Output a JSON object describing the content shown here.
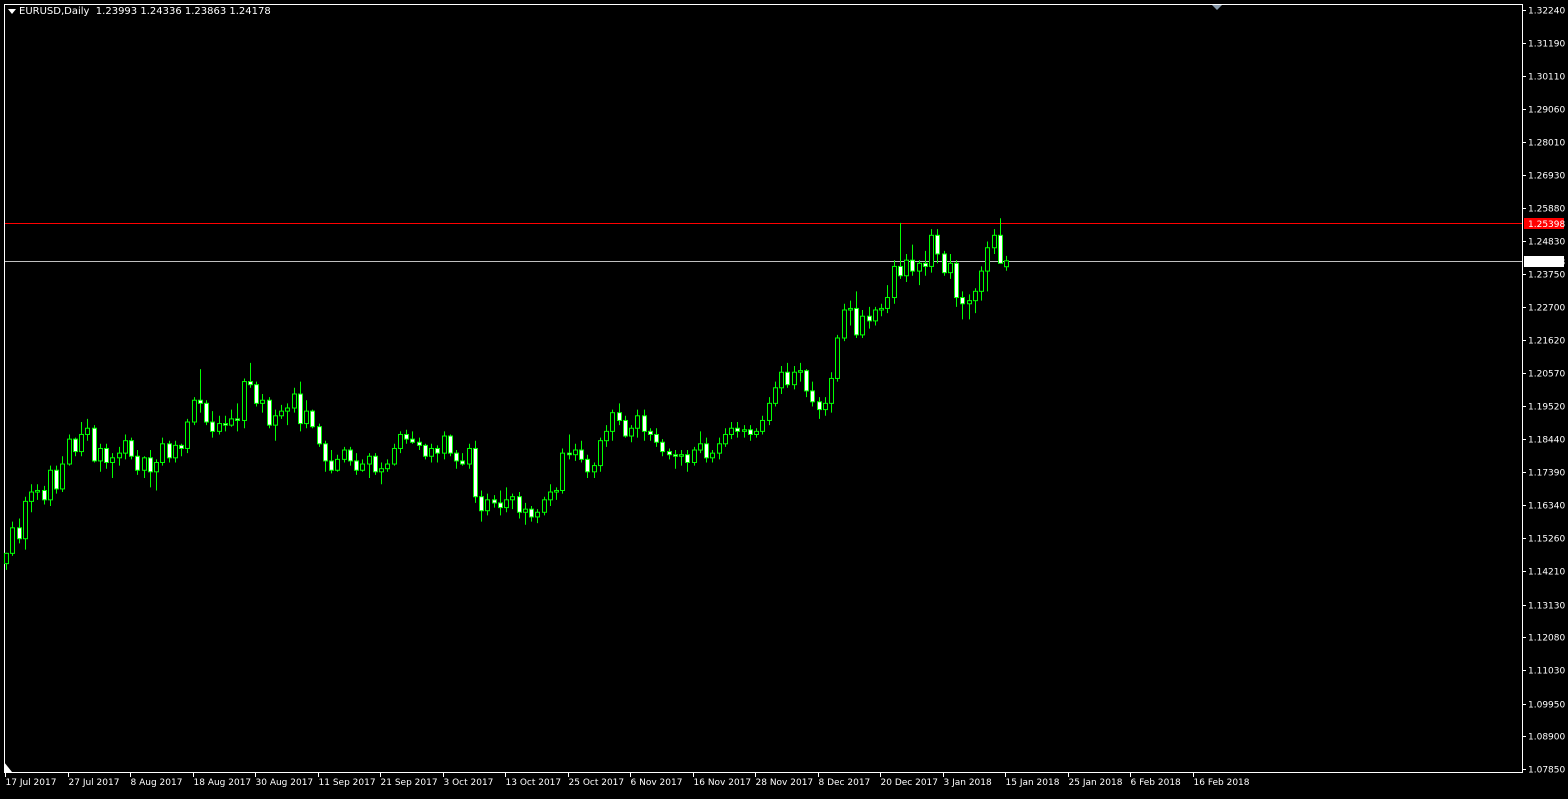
{
  "colors": {
    "background": "#000000",
    "frame": "#ffffff",
    "bull_body": "#000000",
    "bear_body": "#ffffff",
    "wick": "#00ff00",
    "red_line": "#ff0000",
    "bid_line": "#c0c0c0",
    "red_label_bg": "#ff0000",
    "bid_label_bg": "#ffffff"
  },
  "header": {
    "symbol_timeframe": "EURUSD,Daily",
    "ohlc": "1.23993 1.24336 1.23863 1.24178"
  },
  "chart_data": {
    "type": "candlestick",
    "x_ticks": [
      "17 Jul 2017",
      "27 Jul 2017",
      "8 Aug 2017",
      "18 Aug 2017",
      "30 Aug 2017",
      "11 Sep 2017",
      "21 Sep 2017",
      "3 Oct 2017",
      "13 Oct 2017",
      "25 Oct 2017",
      "6 Nov 2017",
      "16 Nov 2017",
      "28 Nov 2017",
      "8 Dec 2017",
      "20 Dec 2017",
      "3 Jan 2018",
      "15 Jan 2018",
      "25 Jan 2018",
      "6 Feb 2018",
      "16 Feb 2018"
    ],
    "y_ticks": [
      "1.32240",
      "1.31190",
      "1.30110",
      "1.29060",
      "1.28010",
      "1.26930",
      "1.25880",
      "1.24830",
      "1.23750",
      "1.22700",
      "1.21620",
      "1.20570",
      "1.19520",
      "1.18440",
      "1.17390",
      "1.16340",
      "1.15260",
      "1.14210",
      "1.13130",
      "1.12080",
      "1.11030",
      "1.09950",
      "1.08900",
      "1.07850"
    ],
    "ylim": [
      1.0785,
      1.3224
    ],
    "horizontal_lines": [
      {
        "value": 1.25398,
        "label": "1.25398",
        "color": "#ff0000"
      },
      {
        "value": 1.24178,
        "label": "1.24178",
        "color": "#c0c0c0"
      }
    ],
    "candles": [
      {
        "o": 1.1445,
        "h": 1.148,
        "l": 1.1425,
        "c": 1.1478
      },
      {
        "o": 1.1478,
        "h": 1.158,
        "l": 1.147,
        "c": 1.156
      },
      {
        "o": 1.156,
        "h": 1.159,
        "l": 1.151,
        "c": 1.1525
      },
      {
        "o": 1.1525,
        "h": 1.166,
        "l": 1.149,
        "c": 1.1645
      },
      {
        "o": 1.1645,
        "h": 1.17,
        "l": 1.161,
        "c": 1.1675
      },
      {
        "o": 1.1675,
        "h": 1.17,
        "l": 1.165,
        "c": 1.168
      },
      {
        "o": 1.168,
        "h": 1.1695,
        "l": 1.1635,
        "c": 1.165
      },
      {
        "o": 1.165,
        "h": 1.176,
        "l": 1.163,
        "c": 1.1745
      },
      {
        "o": 1.1745,
        "h": 1.176,
        "l": 1.167,
        "c": 1.1685
      },
      {
        "o": 1.1685,
        "h": 1.179,
        "l": 1.1675,
        "c": 1.1765
      },
      {
        "o": 1.1765,
        "h": 1.186,
        "l": 1.176,
        "c": 1.1845
      },
      {
        "o": 1.1845,
        "h": 1.185,
        "l": 1.179,
        "c": 1.1805
      },
      {
        "o": 1.1805,
        "h": 1.19,
        "l": 1.179,
        "c": 1.186
      },
      {
        "o": 1.186,
        "h": 1.191,
        "l": 1.184,
        "c": 1.188
      },
      {
        "o": 1.188,
        "h": 1.189,
        "l": 1.177,
        "c": 1.1775
      },
      {
        "o": 1.1775,
        "h": 1.183,
        "l": 1.174,
        "c": 1.1815
      },
      {
        "o": 1.1815,
        "h": 1.183,
        "l": 1.175,
        "c": 1.177
      },
      {
        "o": 1.177,
        "h": 1.18,
        "l": 1.172,
        "c": 1.1785
      },
      {
        "o": 1.1785,
        "h": 1.182,
        "l": 1.176,
        "c": 1.18
      },
      {
        "o": 1.18,
        "h": 1.186,
        "l": 1.178,
        "c": 1.184
      },
      {
        "o": 1.184,
        "h": 1.185,
        "l": 1.178,
        "c": 1.179
      },
      {
        "o": 1.179,
        "h": 1.181,
        "l": 1.173,
        "c": 1.1745
      },
      {
        "o": 1.1745,
        "h": 1.179,
        "l": 1.172,
        "c": 1.1785
      },
      {
        "o": 1.1785,
        "h": 1.181,
        "l": 1.169,
        "c": 1.174
      },
      {
        "o": 1.174,
        "h": 1.178,
        "l": 1.168,
        "c": 1.177
      },
      {
        "o": 1.177,
        "h": 1.185,
        "l": 1.176,
        "c": 1.183
      },
      {
        "o": 1.183,
        "h": 1.184,
        "l": 1.177,
        "c": 1.1785
      },
      {
        "o": 1.1785,
        "h": 1.184,
        "l": 1.177,
        "c": 1.1825
      },
      {
        "o": 1.1825,
        "h": 1.183,
        "l": 1.179,
        "c": 1.1815
      },
      {
        "o": 1.1815,
        "h": 1.191,
        "l": 1.18,
        "c": 1.19
      },
      {
        "o": 1.19,
        "h": 1.198,
        "l": 1.189,
        "c": 1.197
      },
      {
        "o": 1.197,
        "h": 1.207,
        "l": 1.193,
        "c": 1.196
      },
      {
        "o": 1.196,
        "h": 1.197,
        "l": 1.189,
        "c": 1.19
      },
      {
        "o": 1.19,
        "h": 1.1935,
        "l": 1.185,
        "c": 1.187
      },
      {
        "o": 1.187,
        "h": 1.192,
        "l": 1.186,
        "c": 1.1895
      },
      {
        "o": 1.1895,
        "h": 1.192,
        "l": 1.187,
        "c": 1.189
      },
      {
        "o": 1.189,
        "h": 1.194,
        "l": 1.1885,
        "c": 1.191
      },
      {
        "o": 1.191,
        "h": 1.196,
        "l": 1.187,
        "c": 1.1905
      },
      {
        "o": 1.1905,
        "h": 1.204,
        "l": 1.188,
        "c": 1.203
      },
      {
        "o": 1.203,
        "h": 1.209,
        "l": 1.201,
        "c": 1.202
      },
      {
        "o": 1.202,
        "h": 1.203,
        "l": 1.195,
        "c": 1.196
      },
      {
        "o": 1.196,
        "h": 1.199,
        "l": 1.193,
        "c": 1.197
      },
      {
        "o": 1.197,
        "h": 1.198,
        "l": 1.188,
        "c": 1.189
      },
      {
        "o": 1.189,
        "h": 1.194,
        "l": 1.184,
        "c": 1.192
      },
      {
        "o": 1.192,
        "h": 1.1955,
        "l": 1.191,
        "c": 1.1935
      },
      {
        "o": 1.1935,
        "h": 1.196,
        "l": 1.189,
        "c": 1.1945
      },
      {
        "o": 1.1945,
        "h": 1.201,
        "l": 1.193,
        "c": 1.199
      },
      {
        "o": 1.199,
        "h": 1.203,
        "l": 1.187,
        "c": 1.1895
      },
      {
        "o": 1.1895,
        "h": 1.197,
        "l": 1.188,
        "c": 1.1935
      },
      {
        "o": 1.1935,
        "h": 1.194,
        "l": 1.188,
        "c": 1.1885
      },
      {
        "o": 1.1885,
        "h": 1.1895,
        "l": 1.182,
        "c": 1.183
      },
      {
        "o": 1.183,
        "h": 1.184,
        "l": 1.174,
        "c": 1.1775
      },
      {
        "o": 1.1775,
        "h": 1.181,
        "l": 1.1735,
        "c": 1.1745
      },
      {
        "o": 1.1745,
        "h": 1.1795,
        "l": 1.174,
        "c": 1.178
      },
      {
        "o": 1.178,
        "h": 1.182,
        "l": 1.177,
        "c": 1.181
      },
      {
        "o": 1.181,
        "h": 1.182,
        "l": 1.176,
        "c": 1.1775
      },
      {
        "o": 1.1775,
        "h": 1.18,
        "l": 1.173,
        "c": 1.1745
      },
      {
        "o": 1.1745,
        "h": 1.178,
        "l": 1.174,
        "c": 1.1765
      },
      {
        "o": 1.1765,
        "h": 1.18,
        "l": 1.172,
        "c": 1.179
      },
      {
        "o": 1.179,
        "h": 1.18,
        "l": 1.173,
        "c": 1.174
      },
      {
        "o": 1.174,
        "h": 1.177,
        "l": 1.17,
        "c": 1.175
      },
      {
        "o": 1.175,
        "h": 1.178,
        "l": 1.174,
        "c": 1.1765
      },
      {
        "o": 1.1765,
        "h": 1.183,
        "l": 1.176,
        "c": 1.1815
      },
      {
        "o": 1.1815,
        "h": 1.187,
        "l": 1.18,
        "c": 1.186
      },
      {
        "o": 1.186,
        "h": 1.1875,
        "l": 1.183,
        "c": 1.1845
      },
      {
        "o": 1.1845,
        "h": 1.187,
        "l": 1.183,
        "c": 1.1835
      },
      {
        "o": 1.1835,
        "h": 1.185,
        "l": 1.181,
        "c": 1.1825
      },
      {
        "o": 1.1825,
        "h": 1.183,
        "l": 1.178,
        "c": 1.179
      },
      {
        "o": 1.179,
        "h": 1.183,
        "l": 1.177,
        "c": 1.1815
      },
      {
        "o": 1.1815,
        "h": 1.1825,
        "l": 1.177,
        "c": 1.18
      },
      {
        "o": 1.18,
        "h": 1.187,
        "l": 1.178,
        "c": 1.1855
      },
      {
        "o": 1.1855,
        "h": 1.186,
        "l": 1.179,
        "c": 1.18
      },
      {
        "o": 1.18,
        "h": 1.181,
        "l": 1.175,
        "c": 1.1775
      },
      {
        "o": 1.1775,
        "h": 1.18,
        "l": 1.176,
        "c": 1.1765
      },
      {
        "o": 1.1765,
        "h": 1.183,
        "l": 1.175,
        "c": 1.1815
      },
      {
        "o": 1.1815,
        "h": 1.184,
        "l": 1.164,
        "c": 1.166
      },
      {
        "o": 1.166,
        "h": 1.168,
        "l": 1.158,
        "c": 1.1615
      },
      {
        "o": 1.1615,
        "h": 1.167,
        "l": 1.16,
        "c": 1.165
      },
      {
        "o": 1.165,
        "h": 1.1665,
        "l": 1.1625,
        "c": 1.164
      },
      {
        "o": 1.164,
        "h": 1.168,
        "l": 1.16,
        "c": 1.1625
      },
      {
        "o": 1.1625,
        "h": 1.169,
        "l": 1.161,
        "c": 1.165
      },
      {
        "o": 1.165,
        "h": 1.167,
        "l": 1.162,
        "c": 1.166
      },
      {
        "o": 1.166,
        "h": 1.1675,
        "l": 1.159,
        "c": 1.161
      },
      {
        "o": 1.161,
        "h": 1.164,
        "l": 1.157,
        "c": 1.162
      },
      {
        "o": 1.162,
        "h": 1.163,
        "l": 1.158,
        "c": 1.1595
      },
      {
        "o": 1.1595,
        "h": 1.162,
        "l": 1.1575,
        "c": 1.161
      },
      {
        "o": 1.161,
        "h": 1.166,
        "l": 1.16,
        "c": 1.165
      },
      {
        "o": 1.165,
        "h": 1.17,
        "l": 1.163,
        "c": 1.1675
      },
      {
        "o": 1.1675,
        "h": 1.169,
        "l": 1.165,
        "c": 1.168
      },
      {
        "o": 1.168,
        "h": 1.1815,
        "l": 1.167,
        "c": 1.18
      },
      {
        "o": 1.18,
        "h": 1.186,
        "l": 1.178,
        "c": 1.1795
      },
      {
        "o": 1.1795,
        "h": 1.183,
        "l": 1.1775,
        "c": 1.181
      },
      {
        "o": 1.181,
        "h": 1.184,
        "l": 1.177,
        "c": 1.178
      },
      {
        "o": 1.178,
        "h": 1.1795,
        "l": 1.172,
        "c": 1.174
      },
      {
        "o": 1.174,
        "h": 1.177,
        "l": 1.172,
        "c": 1.176
      },
      {
        "o": 1.176,
        "h": 1.185,
        "l": 1.174,
        "c": 1.184
      },
      {
        "o": 1.184,
        "h": 1.189,
        "l": 1.182,
        "c": 1.187
      },
      {
        "o": 1.187,
        "h": 1.194,
        "l": 1.184,
        "c": 1.193
      },
      {
        "o": 1.193,
        "h": 1.196,
        "l": 1.189,
        "c": 1.1905
      },
      {
        "o": 1.1905,
        "h": 1.192,
        "l": 1.185,
        "c": 1.1855
      },
      {
        "o": 1.1855,
        "h": 1.189,
        "l": 1.1835,
        "c": 1.188
      },
      {
        "o": 1.188,
        "h": 1.194,
        "l": 1.185,
        "c": 1.192
      },
      {
        "o": 1.192,
        "h": 1.194,
        "l": 1.184,
        "c": 1.187
      },
      {
        "o": 1.187,
        "h": 1.188,
        "l": 1.184,
        "c": 1.186
      },
      {
        "o": 1.186,
        "h": 1.188,
        "l": 1.182,
        "c": 1.1835
      },
      {
        "o": 1.1835,
        "h": 1.1845,
        "l": 1.179,
        "c": 1.1805
      },
      {
        "o": 1.1805,
        "h": 1.1815,
        "l": 1.178,
        "c": 1.1795
      },
      {
        "o": 1.1795,
        "h": 1.181,
        "l": 1.175,
        "c": 1.179
      },
      {
        "o": 1.179,
        "h": 1.181,
        "l": 1.176,
        "c": 1.1795
      },
      {
        "o": 1.1795,
        "h": 1.181,
        "l": 1.174,
        "c": 1.177
      },
      {
        "o": 1.177,
        "h": 1.182,
        "l": 1.176,
        "c": 1.181
      },
      {
        "o": 1.181,
        "h": 1.187,
        "l": 1.18,
        "c": 1.183
      },
      {
        "o": 1.183,
        "h": 1.185,
        "l": 1.177,
        "c": 1.1785
      },
      {
        "o": 1.1785,
        "h": 1.181,
        "l": 1.177,
        "c": 1.18
      },
      {
        "o": 1.18,
        "h": 1.185,
        "l": 1.178,
        "c": 1.183
      },
      {
        "o": 1.183,
        "h": 1.188,
        "l": 1.182,
        "c": 1.186
      },
      {
        "o": 1.186,
        "h": 1.19,
        "l": 1.1845,
        "c": 1.188
      },
      {
        "o": 1.188,
        "h": 1.19,
        "l": 1.185,
        "c": 1.187
      },
      {
        "o": 1.187,
        "h": 1.189,
        "l": 1.185,
        "c": 1.1875
      },
      {
        "o": 1.1875,
        "h": 1.189,
        "l": 1.184,
        "c": 1.186
      },
      {
        "o": 1.186,
        "h": 1.188,
        "l": 1.185,
        "c": 1.187
      },
      {
        "o": 1.187,
        "h": 1.192,
        "l": 1.186,
        "c": 1.1905
      },
      {
        "o": 1.1905,
        "h": 1.198,
        "l": 1.189,
        "c": 1.196
      },
      {
        "o": 1.196,
        "h": 1.203,
        "l": 1.195,
        "c": 1.201
      },
      {
        "o": 1.201,
        "h": 1.208,
        "l": 1.199,
        "c": 1.206
      },
      {
        "o": 1.206,
        "h": 1.209,
        "l": 1.201,
        "c": 1.202
      },
      {
        "o": 1.202,
        "h": 1.208,
        "l": 1.2005,
        "c": 1.206
      },
      {
        "o": 1.206,
        "h": 1.209,
        "l": 1.203,
        "c": 1.2065
      },
      {
        "o": 1.2065,
        "h": 1.207,
        "l": 1.198,
        "c": 1.2
      },
      {
        "o": 1.2,
        "h": 1.203,
        "l": 1.195,
        "c": 1.1965
      },
      {
        "o": 1.1965,
        "h": 1.198,
        "l": 1.191,
        "c": 1.194
      },
      {
        "o": 1.194,
        "h": 1.198,
        "l": 1.192,
        "c": 1.196
      },
      {
        "o": 1.196,
        "h": 1.206,
        "l": 1.193,
        "c": 1.204
      },
      {
        "o": 1.204,
        "h": 1.218,
        "l": 1.203,
        "c": 1.217
      },
      {
        "o": 1.217,
        "h": 1.228,
        "l": 1.216,
        "c": 1.226
      },
      {
        "o": 1.226,
        "h": 1.229,
        "l": 1.221,
        "c": 1.2265
      },
      {
        "o": 1.2265,
        "h": 1.232,
        "l": 1.217,
        "c": 1.218
      },
      {
        "o": 1.218,
        "h": 1.226,
        "l": 1.217,
        "c": 1.224
      },
      {
        "o": 1.224,
        "h": 1.227,
        "l": 1.22,
        "c": 1.2225
      },
      {
        "o": 1.2225,
        "h": 1.227,
        "l": 1.221,
        "c": 1.226
      },
      {
        "o": 1.226,
        "h": 1.228,
        "l": 1.224,
        "c": 1.2265
      },
      {
        "o": 1.2265,
        "h": 1.234,
        "l": 1.225,
        "c": 1.23
      },
      {
        "o": 1.23,
        "h": 1.242,
        "l": 1.228,
        "c": 1.24
      },
      {
        "o": 1.24,
        "h": 1.254,
        "l": 1.236,
        "c": 1.237
      },
      {
        "o": 1.237,
        "h": 1.244,
        "l": 1.235,
        "c": 1.242
      },
      {
        "o": 1.242,
        "h": 1.247,
        "l": 1.237,
        "c": 1.2385
      },
      {
        "o": 1.2385,
        "h": 1.242,
        "l": 1.234,
        "c": 1.241
      },
      {
        "o": 1.241,
        "h": 1.245,
        "l": 1.237,
        "c": 1.24
      },
      {
        "o": 1.24,
        "h": 1.252,
        "l": 1.238,
        "c": 1.25
      },
      {
        "o": 1.25,
        "h": 1.252,
        "l": 1.241,
        "c": 1.244
      },
      {
        "o": 1.244,
        "h": 1.245,
        "l": 1.237,
        "c": 1.238
      },
      {
        "o": 1.238,
        "h": 1.244,
        "l": 1.236,
        "c": 1.241
      },
      {
        "o": 1.241,
        "h": 1.242,
        "l": 1.227,
        "c": 1.23
      },
      {
        "o": 1.23,
        "h": 1.232,
        "l": 1.223,
        "c": 1.228
      },
      {
        "o": 1.228,
        "h": 1.231,
        "l": 1.223,
        "c": 1.229
      },
      {
        "o": 1.229,
        "h": 1.233,
        "l": 1.225,
        "c": 1.232
      },
      {
        "o": 1.232,
        "h": 1.24,
        "l": 1.229,
        "c": 1.2385
      },
      {
        "o": 1.2385,
        "h": 1.248,
        "l": 1.232,
        "c": 1.246
      },
      {
        "o": 1.246,
        "h": 1.252,
        "l": 1.244,
        "c": 1.25
      },
      {
        "o": 1.25,
        "h": 1.2555,
        "l": 1.241,
        "c": 1.241
      },
      {
        "o": 1.2399,
        "h": 1.2434,
        "l": 1.2386,
        "c": 1.2418
      }
    ]
  }
}
